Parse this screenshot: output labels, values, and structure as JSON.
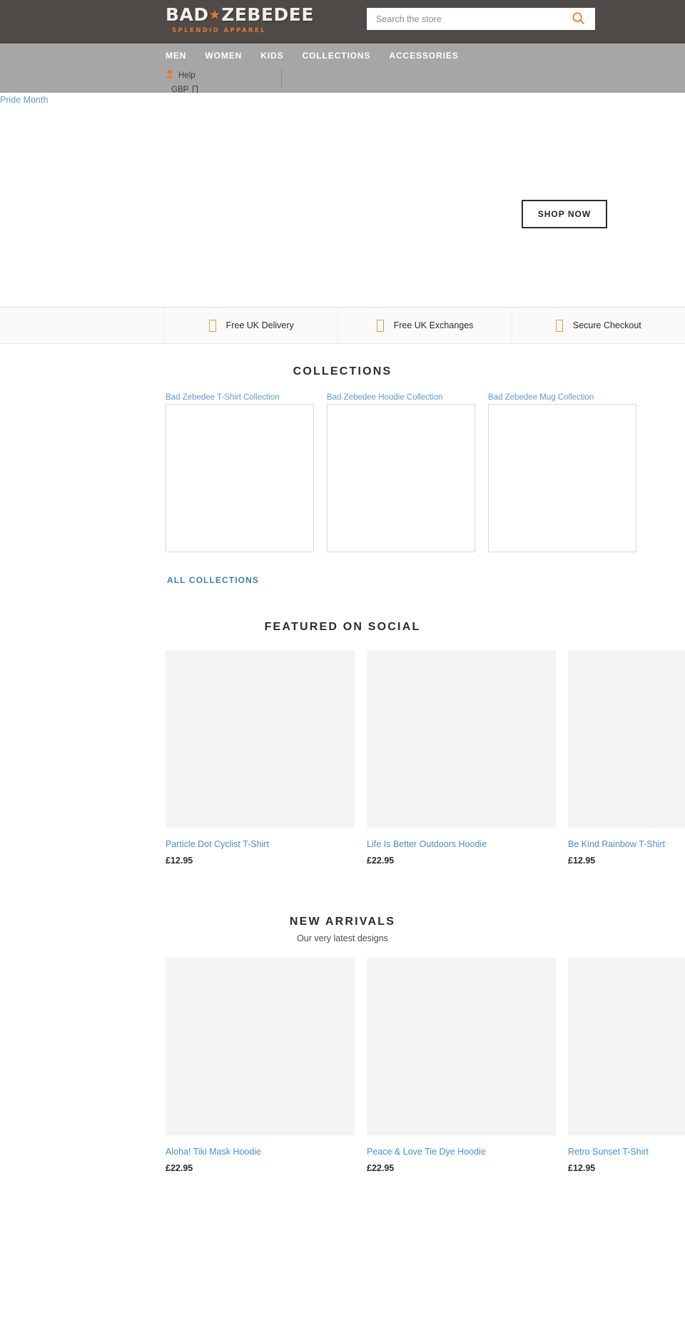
{
  "header": {
    "logo": {
      "name_part1": "BAD",
      "star": "★",
      "name_part2": "ZEBEDEE",
      "tagline": "SPLENDID APPAREL"
    },
    "search": {
      "placeholder": "Search the store",
      "value": "",
      "icon": "search-icon"
    }
  },
  "nav": {
    "links": [
      {
        "label": "MEN"
      },
      {
        "label": "WOMEN"
      },
      {
        "label": "KIDS"
      },
      {
        "label": "COLLECTIONS"
      },
      {
        "label": "ACCESSORIES"
      }
    ],
    "help_label": "Help",
    "help_icon": "person-icon",
    "currency_label": "GBP",
    "currency_caret": "▾"
  },
  "hero": {
    "image_alt": "Pride Month",
    "shop_button": "SHOP NOW"
  },
  "benefits": [
    {
      "label": "Free UK Delivery",
      "icon": "box-icon"
    },
    {
      "label": "Free UK Exchanges",
      "icon": "box-icon"
    },
    {
      "label": "Secure Checkout",
      "icon": "box-icon"
    }
  ],
  "collections": {
    "title": "COLLECTIONS",
    "items": [
      {
        "alt": "Bad Zebedee T-Shirt Collection"
      },
      {
        "alt": "Bad Zebedee Hoodie Collection"
      },
      {
        "alt": "Bad Zebedee Mug Collection"
      }
    ],
    "all_button": "ALL COLLECTIONS"
  },
  "featured": {
    "title": "FEATURED ON SOCIAL",
    "items": [
      {
        "name": "Particle Dot Cyclist T-Shirt",
        "price": "£12.95"
      },
      {
        "name": "Life Is Better Outdoors Hoodie",
        "price": "£22.95"
      },
      {
        "name": "Be Kind Rainbow T-Shirt",
        "price": "£12.95"
      }
    ]
  },
  "new_arrivals": {
    "title": "NEW ARRIVALS",
    "subtitle": "Our very latest designs",
    "items": [
      {
        "name": "Aloha! Tiki Mask Hoodie",
        "price": "£22.95"
      },
      {
        "name": "Peace & Love Tie Dye Hoodie",
        "price": "£22.95"
      },
      {
        "name": "Retro Sunset T-Shirt",
        "price": "£12.95"
      }
    ]
  }
}
